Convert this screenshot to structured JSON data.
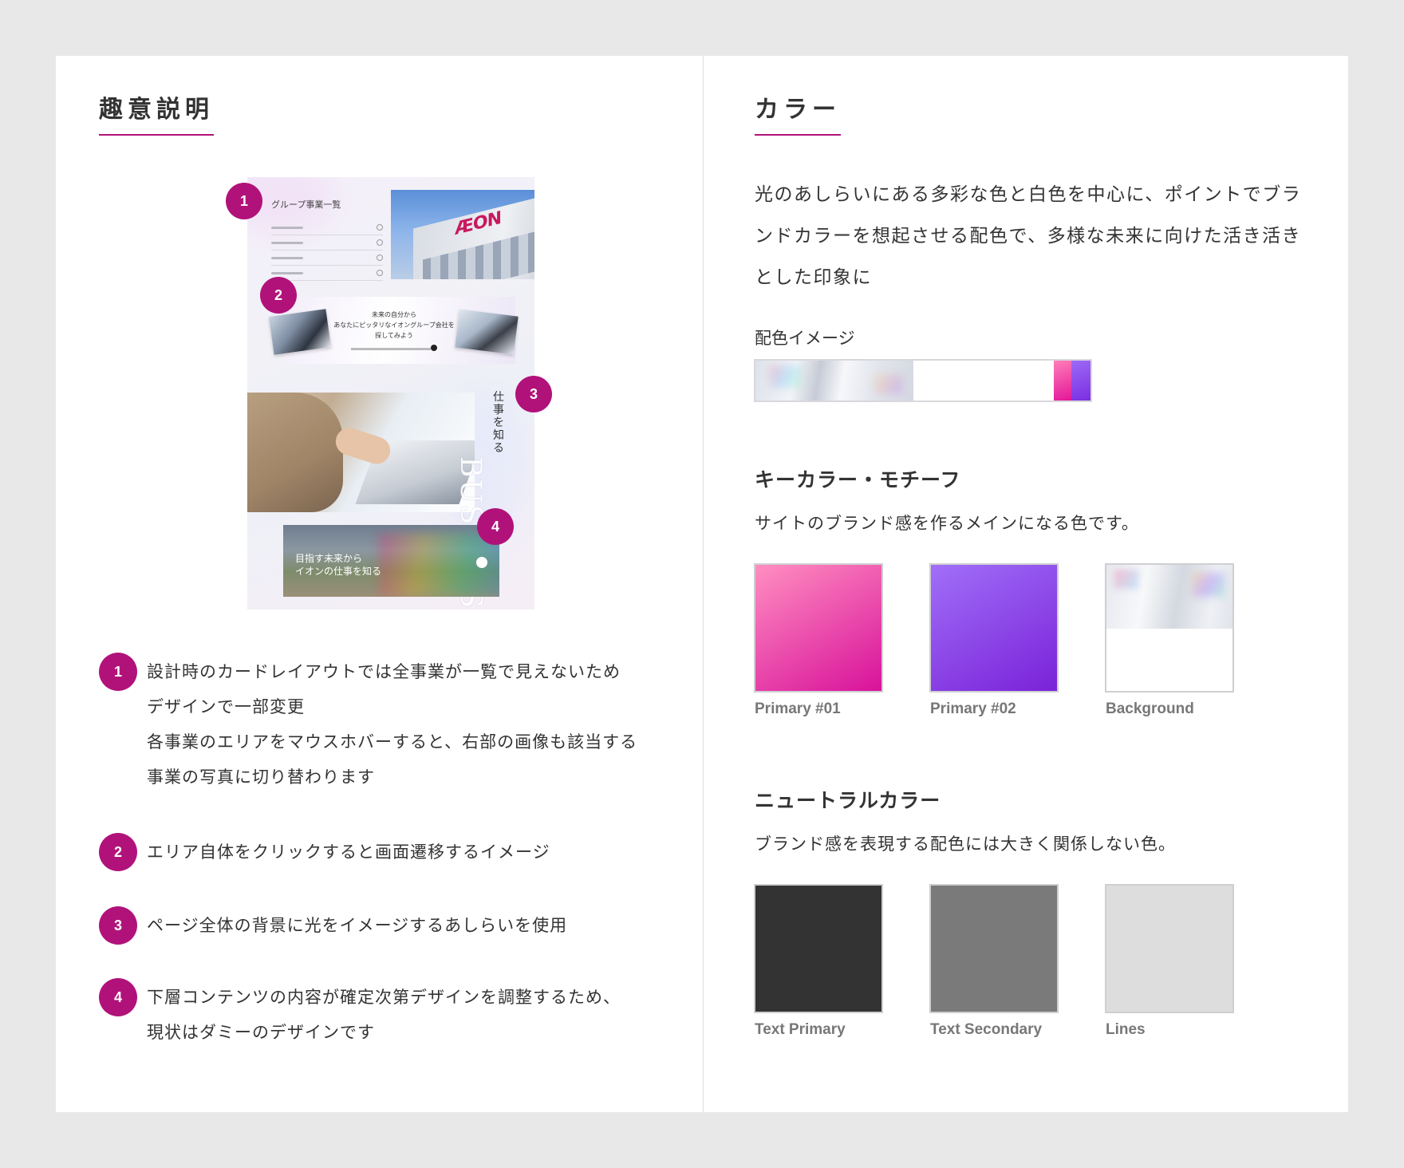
{
  "left": {
    "heading": "趣意説明",
    "mockup": {
      "group_title": "グループ事業一覧",
      "banner2_text": "未来の自分から\nあなたにピッタリなイオングループ会社を\n探してみよう",
      "vertical_text": "仕事を知る",
      "vertical_en": "BUSINESS",
      "banner4_text": "目指す未来から\nイオンの仕事を知る",
      "logo": "ÆON",
      "badges": [
        "1",
        "2",
        "3",
        "4"
      ]
    },
    "notes": [
      {
        "num": "1",
        "text": "設計時のカードレイアウトでは全事業が一覧で見えないため\nデザインで一部変更\n各事業のエリアをマウスホバーすると、右部の画像も該当する\n事業の写真に切り替わります"
      },
      {
        "num": "2",
        "text": "エリア自体をクリックすると画面遷移するイメージ"
      },
      {
        "num": "3",
        "text": "ページ全体の背景に光をイメージするあしらいを使用"
      },
      {
        "num": "4",
        "text": "下層コンテンツの内容が確定次第デザインを調整するため、\n現状はダミーのデザインです"
      }
    ]
  },
  "right": {
    "heading": "カラー",
    "intro": "光のあしらいにある多彩な色と白色を中心に、ポイントでブランドカラーを想起させる配色で、多様な未来に向けた活き活きとした印象に",
    "image_label": "配色イメージ",
    "key": {
      "title": "キーカラー・モチーフ",
      "desc": "サイトのブランド感を作るメインになる色です。",
      "swatches": [
        {
          "label": "Primary #01",
          "from": "#ff8ec0",
          "to": "#d8129a"
        },
        {
          "label": "Primary #02",
          "from": "#a06ff8",
          "to": "#7a22d8"
        },
        {
          "label": "Background",
          "from": "#dfe3ea",
          "to": "#ffffff"
        }
      ]
    },
    "neutral": {
      "title": "ニュートラルカラー",
      "desc": "ブランド感を表現する配色には大きく関係しない色。",
      "swatches": [
        {
          "label": "Text Primary",
          "color": "#333333"
        },
        {
          "label": "Text Secondary",
          "color": "#7a7a7a"
        },
        {
          "label": "Lines",
          "color": "#dddddd"
        }
      ]
    }
  },
  "colors": {
    "accent": "#b1127a"
  }
}
